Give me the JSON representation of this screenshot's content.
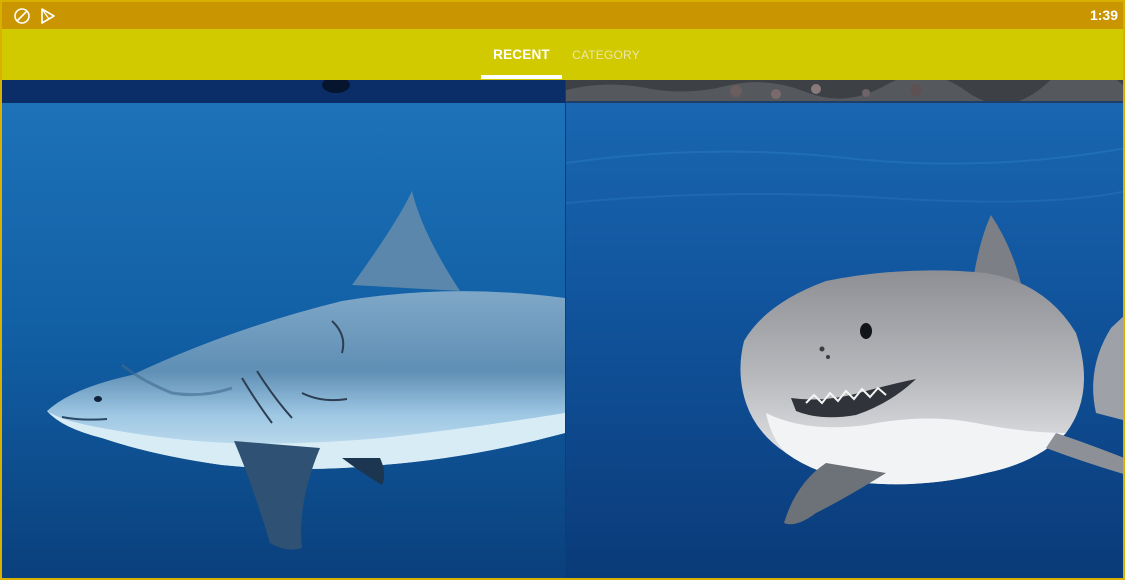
{
  "status_bar": {
    "time": "1:39",
    "icons": [
      "screen-rotation-icon",
      "play-store-icon"
    ]
  },
  "tabs": [
    {
      "label": "RECENT",
      "selected": true
    },
    {
      "label": "CATEGORY",
      "selected": false
    }
  ],
  "wallpapers": [
    {
      "description": "dark blue partial image"
    },
    {
      "description": "rocky seabed partial image"
    },
    {
      "description": "great white shark swimming left in blue water"
    },
    {
      "description": "great white shark facing viewer in deep blue water"
    }
  ],
  "colors": {
    "status_bar": "#c99500",
    "toolbar": "#d2ca00",
    "tab_selected": "#ffffff",
    "tab_unselected": "#ece6a8"
  }
}
